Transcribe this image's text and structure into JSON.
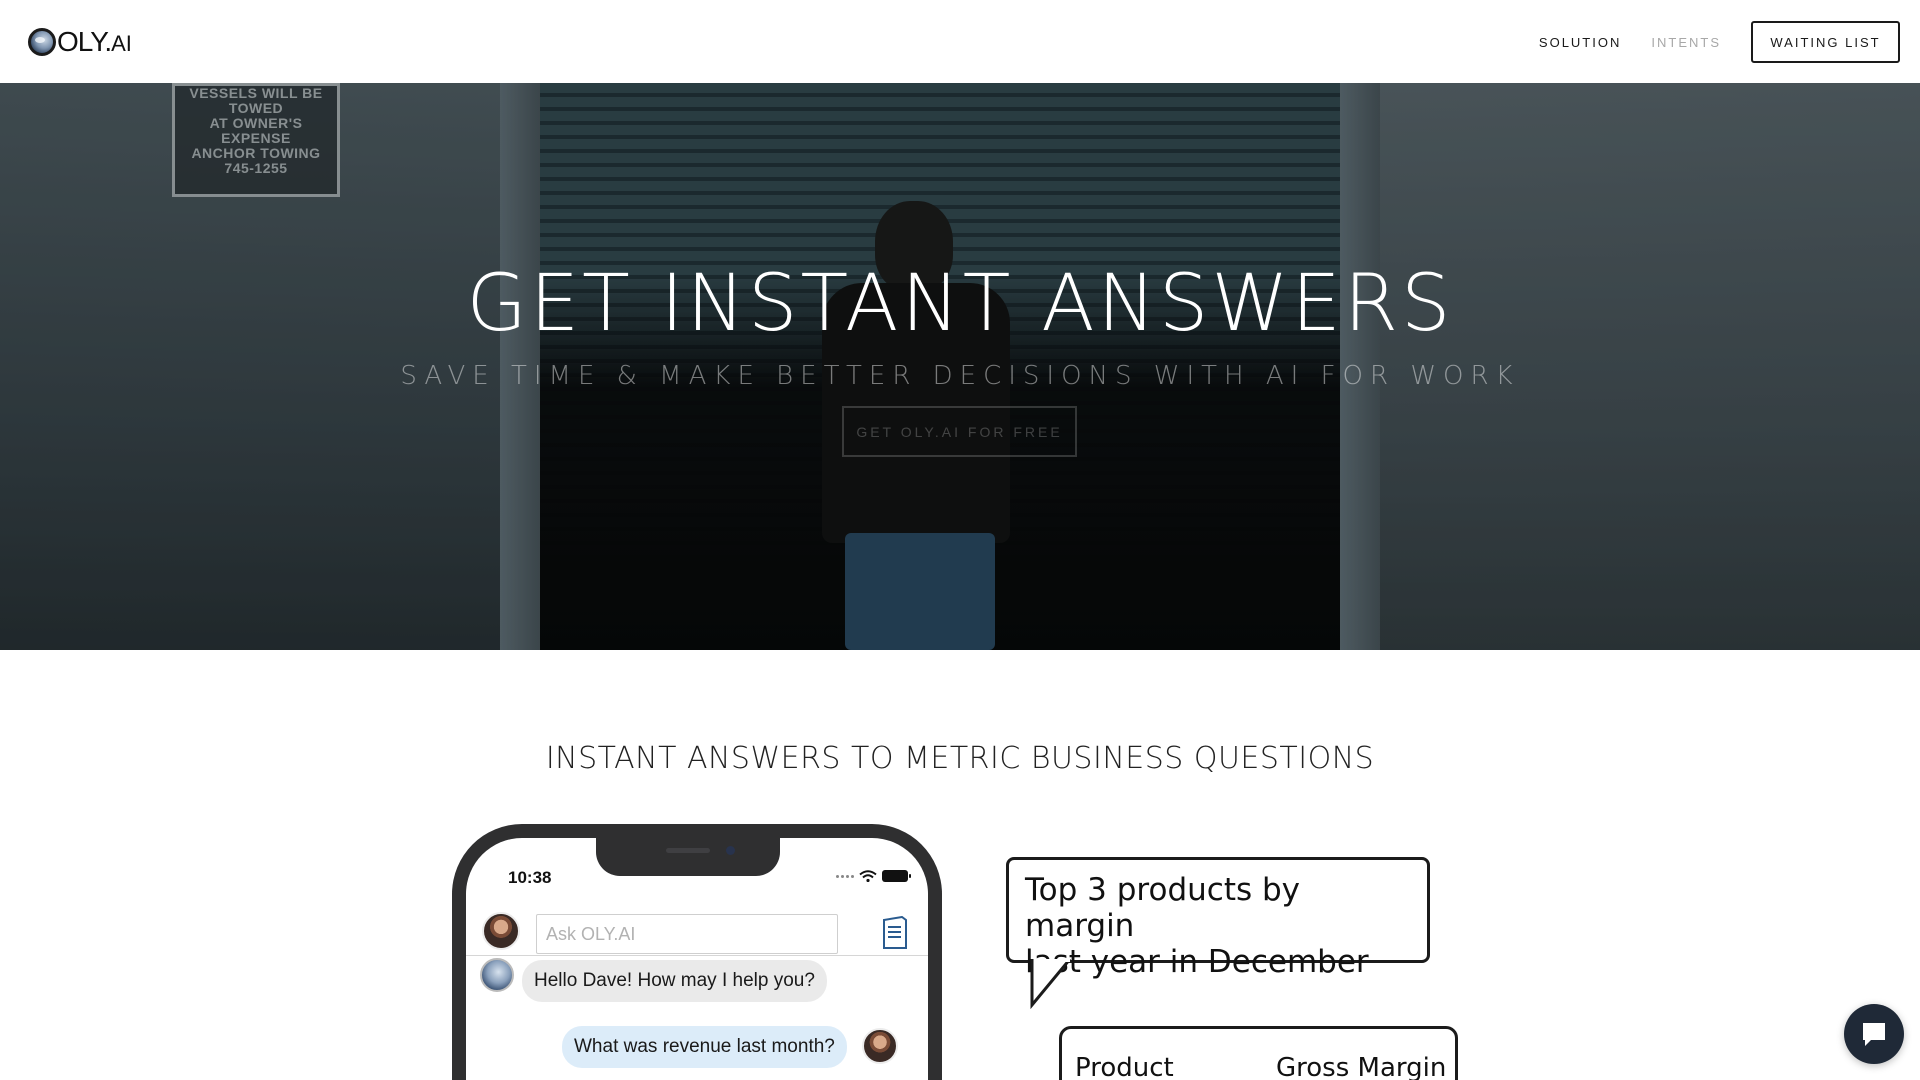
{
  "brand": {
    "logo_main": "OLY.",
    "logo_suffix": "AI"
  },
  "nav": {
    "links": [
      "SOLUTION",
      "INTENTS"
    ],
    "cta": "WAITING LIST"
  },
  "hero": {
    "title": "GET INSTANT ANSWERS",
    "subtitle": "SAVE TIME & MAKE BETTER DECISIONS WITH AI FOR WORK",
    "cta": "GET OLY.AI FOR FREE",
    "background_sign": [
      "VESSELS WILL BE TOWED",
      "AT OWNER'S EXPENSE",
      "ANCHOR TOWING",
      "745-1255"
    ]
  },
  "section": {
    "title": "INSTANT ANSWERS TO METRIC BUSINESS QUESTIONS"
  },
  "phone": {
    "time": "10:38",
    "ask_placeholder": "Ask OLY.AI",
    "messages": [
      {
        "from": "oly",
        "text": "Hello Dave! How may I help you?"
      },
      {
        "from": "user",
        "text": "What was revenue last month?"
      }
    ]
  },
  "example": {
    "question": "Top 3 products by margin last year in December",
    "question_line1": "Top 3 products by margin",
    "question_line2": "last year in December",
    "table_headers": [
      "Product",
      "Gross Margin"
    ]
  },
  "colors": {
    "nav_text": "#1a1a1a",
    "nav_dim": "#a8a8a8",
    "chat_widget": "#1f2937",
    "bubble_in": "#eaeaea",
    "bubble_out": "#dcecf9"
  },
  "icons": {
    "chat_widget": "chat-bubble-icon",
    "document": "document-icon"
  }
}
